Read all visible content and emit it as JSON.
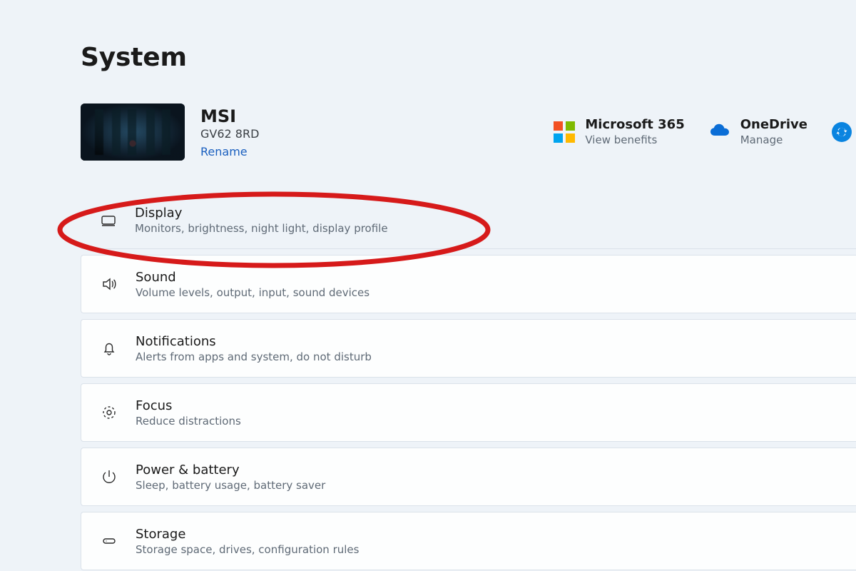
{
  "page_title": "System",
  "device": {
    "name": "MSI",
    "model": "GV62 8RD",
    "rename_label": "Rename"
  },
  "services": {
    "ms365": {
      "title": "Microsoft 365",
      "action": "View benefits"
    },
    "onedrive": {
      "title": "OneDrive",
      "action": "Manage"
    }
  },
  "settings": [
    {
      "key": "display",
      "title": "Display",
      "desc": "Monitors, brightness, night light, display profile"
    },
    {
      "key": "sound",
      "title": "Sound",
      "desc": "Volume levels, output, input, sound devices"
    },
    {
      "key": "notifications",
      "title": "Notifications",
      "desc": "Alerts from apps and system, do not disturb"
    },
    {
      "key": "focus",
      "title": "Focus",
      "desc": "Reduce distractions"
    },
    {
      "key": "power",
      "title": "Power & battery",
      "desc": "Sleep, battery usage, battery saver"
    },
    {
      "key": "storage",
      "title": "Storage",
      "desc": "Storage space, drives, configuration rules"
    }
  ],
  "annotation": {
    "highlighted_setting_key": "display",
    "color": "#d61a1a"
  }
}
